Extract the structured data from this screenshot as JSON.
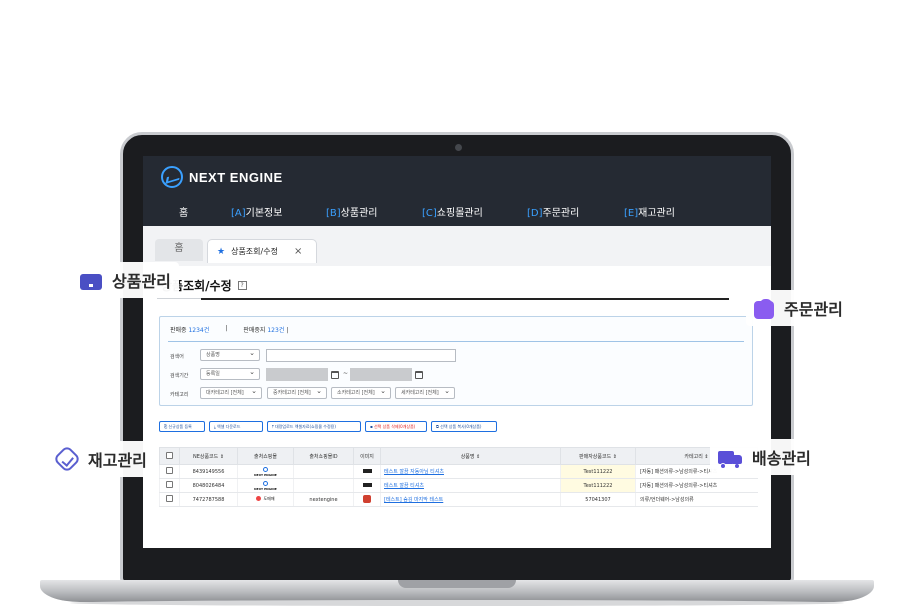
{
  "app": {
    "logo_text": "NEXT ENGINE",
    "nav": [
      {
        "label": "홈",
        "prefix": ""
      },
      {
        "label": "기본정보",
        "prefix": "[A]"
      },
      {
        "label": "상품관리",
        "prefix": "[B]"
      },
      {
        "label": "쇼핑몰관리",
        "prefix": "[C]"
      },
      {
        "label": "주문관리",
        "prefix": "[D]"
      },
      {
        "label": "재고관리",
        "prefix": "[E]"
      }
    ],
    "tabs": {
      "home_label": "홈",
      "active_label": "상품조회/수정",
      "close_glyph": "×"
    },
    "page_title": "상품조회/수정",
    "help_glyph": "?"
  },
  "search_panel": {
    "on_sale_label": "판매중",
    "on_sale_count": "1234건",
    "stopped_label": "판매중지",
    "stopped_count": "123건",
    "keyword_label": "검색어",
    "keyword_select": "상품명",
    "period_label": "검색기간",
    "period_select": "등록일",
    "range_sep": "~",
    "category_label": "카테고리",
    "category_selects": [
      "대카테고리 [전체]",
      "중카테고리 [전체]",
      "소카테고리 [전체]",
      "세카테고리 [전체]"
    ]
  },
  "actions": [
    "신규상품 등록",
    "엑셀 다운로드",
    "대량업로드 엑셀자료(쇼핑몰 수정용)",
    "선택 상품 삭제(0개상품)",
    "선택 상품 복사(0개상품)"
  ],
  "table": {
    "headers": [
      "",
      "NE상품코드 ⇕",
      "출처쇼핑몰",
      "출처쇼핑몰ID",
      "이미지",
      "상품명 ⇕",
      "판매자상품코드 ⇕",
      "카테고리 ⇕"
    ],
    "rows": [
      {
        "code": "8439149556",
        "source": "NEXT ENGINE",
        "source_id": "",
        "name": "테스트 깔끔 자동아님 티셔츠",
        "seller_code": "Test111222",
        "category": "[자동] 패션의류->남성의류->티셔츠"
      },
      {
        "code": "8048026484",
        "source": "NEXT ENGINE",
        "source_id": "",
        "name": "테스트 깔끔 티셔츠",
        "seller_code": "Test111222",
        "category": "[자동] 패션의류->남성의류->티셔츠"
      },
      {
        "code": "7472787588",
        "source": "도매매",
        "source_id": "nextengine",
        "name": "[테스트] 숨김 마지막 테스트",
        "seller_code": "57041307",
        "category": "의류/언더웨어->남성의류"
      }
    ]
  },
  "features": {
    "product": "상품관리",
    "order": "주문관리",
    "stock": "재고관리",
    "shipping": "배송관리"
  },
  "colors": {
    "header_bg": "#252a33",
    "accent_blue": "#1e6fe0",
    "feature_icon_purple": "#5a4fd8"
  }
}
